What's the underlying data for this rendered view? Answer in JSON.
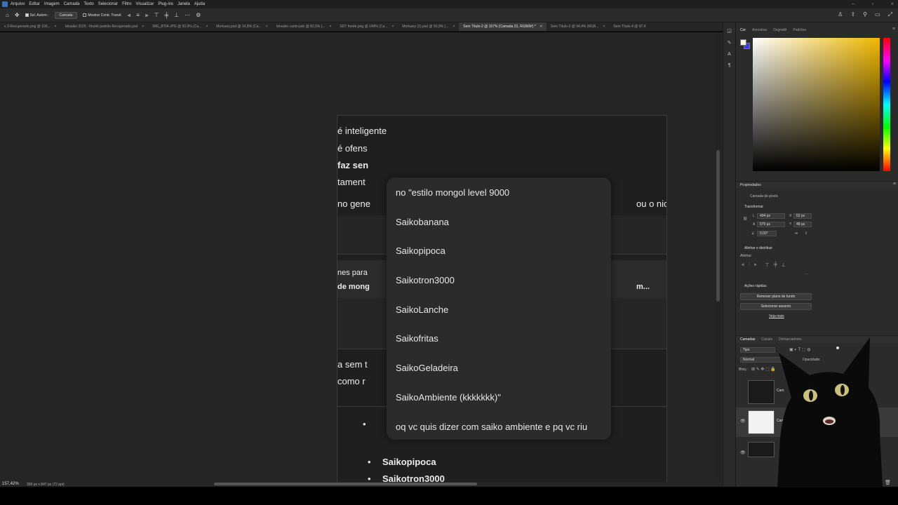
{
  "menu": {
    "items": [
      "Arquivo",
      "Editar",
      "Imagem",
      "Camada",
      "Texto",
      "Selecionar",
      "Filtro",
      "Visualizar",
      "Plug-ins",
      "Janela",
      "Ajuda"
    ]
  },
  "options_bar": {
    "auto_select_label": "Sel. Autom.:",
    "layer_select_value": "Camada",
    "show_transform_label": "Mostrar Contr. Transf."
  },
  "tabs": [
    {
      "label": "x 3-Recuperado.png @ 100...",
      "active": false
    },
    {
      "label": "Idrsaiko 2025 - thumb padrão-Recuperado.psd",
      "active": false
    },
    {
      "label": "IMG_8704.JPG @ 93,9% (Ca...",
      "active": false
    },
    {
      "label": "Mortuary.psd @ 14,8% (Ca...",
      "active": false
    },
    {
      "label": "Idrsaiko canto.psb @ 82,6% (...",
      "active": false
    },
    {
      "label": "SDT frente.png @ 149% (Ca...",
      "active": false
    },
    {
      "label": "Mortuary (1).psd @ 50,9% (...",
      "active": false
    },
    {
      "label": "Sem Título-2 @ 157% (Camada 22, RGB/8#) *",
      "active": true
    },
    {
      "label": "Sem Título-3 @ 94,4% (RGB...",
      "active": false
    },
    {
      "label": "Sem Título-4 @ 97,4",
      "active": false
    }
  ],
  "document": {
    "lines": [
      "é inteligente",
      "é ofens",
      "faz sen",
      "tament",
      "no gene",
      "ou o nic",
      "nes para",
      "de mong",
      "m...",
      "a sem t",
      "como r",
      "Saikopipoca",
      "Saikotron3000"
    ]
  },
  "popup": {
    "options": [
      "no \"estilo mongol level 9000",
      "Saikobanana",
      "Saikopipoca",
      "Saikotron3000",
      "SaikoLanche",
      "Saikofritas",
      "SaikoGeladeira",
      "SaikoAmbiente (kkkkkkk)\"",
      "oq vc quis dizer  com saiko ambiente e pq vc riu"
    ]
  },
  "status": {
    "zoom": "157,42%",
    "doc_info": "399 px x 847 px (72 ppi)"
  },
  "color_panel": {
    "tabs": [
      "Cor",
      "Amostras",
      "Degradê",
      "Padrões"
    ],
    "foreground": "#f8f5e4",
    "background": "#3c3cff",
    "hue_color": "#f0b800"
  },
  "properties": {
    "title": "Propriedades",
    "layer_type": "Camada de pixels",
    "transform_label": "Transformar",
    "w": "494 px",
    "h": "575 px",
    "x": "52 px",
    "y": "48 px",
    "angle": "0,00°",
    "align_title": "Alinhar e distribuir",
    "align_label": "Alinhar:",
    "quick_actions": "Ações rápidas",
    "remove_bg": "Remover plano de fundo",
    "select_subject": "Selecionar assunto",
    "see_more": "Veja mais"
  },
  "layers": {
    "tabs": [
      "Camadas",
      "Canais",
      "Demarcadores"
    ],
    "filter": "Tipo",
    "blend_mode": "Normal",
    "opacity_label": "Opacidade:",
    "lock_label": "Bloq.:",
    "items": [
      {
        "name": "Cam",
        "selected": false,
        "visible": false
      },
      {
        "name": "Cam",
        "selected": true,
        "visible": true
      },
      {
        "name": "",
        "selected": false,
        "visible": true
      }
    ]
  }
}
